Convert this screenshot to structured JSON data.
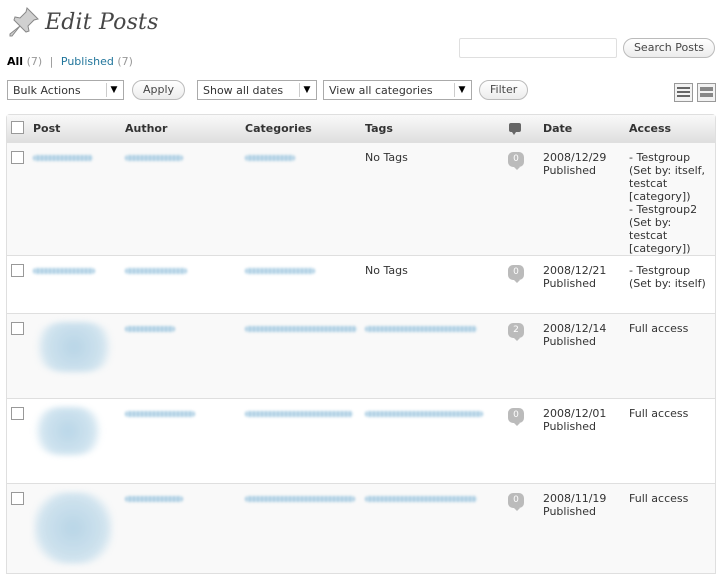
{
  "page": {
    "title": "Edit Posts"
  },
  "filters": {
    "all_label": "All",
    "all_count": "(7)",
    "separator": "|",
    "published_label": "Published",
    "published_count": "(7)"
  },
  "search": {
    "value": "",
    "placeholder": "",
    "button_label": "Search Posts"
  },
  "tablenav": {
    "bulk_actions": "Bulk Actions",
    "apply_label": "Apply",
    "dates": "Show all dates",
    "categories": "View all categories",
    "filter_label": "Filter",
    "arrow": "▼"
  },
  "table": {
    "columns": {
      "post": "Post",
      "author": "Author",
      "categories": "Categories",
      "tags": "Tags",
      "date": "Date",
      "access": "Access"
    },
    "rows": [
      {
        "tags": "No Tags",
        "comments": "0",
        "date": "2008/12/29",
        "status": "Published",
        "access": [
          "- Testgroup",
          "(Set by: itself,",
          "testcat",
          "[category])",
          "- Testgroup2",
          "(Set by: testcat",
          "[category])"
        ]
      },
      {
        "tags": "No Tags",
        "comments": "0",
        "date": "2008/12/21",
        "status": "Published",
        "access": [
          "- Testgroup",
          "(Set by: itself)"
        ]
      },
      {
        "tags": "",
        "comments": "2",
        "date": "2008/12/14",
        "status": "Published",
        "access": [
          "Full access"
        ]
      },
      {
        "tags": "",
        "comments": "0",
        "date": "2008/12/01",
        "status": "Published",
        "access": [
          "Full access"
        ]
      },
      {
        "tags": "",
        "comments": "0",
        "date": "2008/11/19",
        "status": "Published",
        "access": [
          "Full access"
        ]
      }
    ]
  },
  "icons": {
    "pin": "pin-icon",
    "comment": "comment-icon",
    "list_view": "list-view-icon",
    "excerpt_view": "excerpt-view-icon"
  },
  "colors": {
    "link": "#21759b",
    "bubble": "#bbbbbb",
    "header_bg": "#dfdfdf"
  }
}
